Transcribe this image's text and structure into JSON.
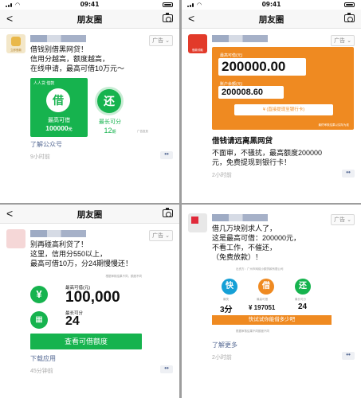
{
  "status": {
    "time": "09:41"
  },
  "nav": {
    "title": "朋友圈",
    "back_glyph": "<"
  },
  "ad_badge": "广告",
  "posts": [
    {
      "avatar_label": "立即借款",
      "text_lines": [
        "借钱别借黑网贷！",
        "信用分越高，额度越高，",
        "在线申请，最高可借10万元～"
      ],
      "image": {
        "brand": "人人贷 借款",
        "card_a": {
          "glyph": "借",
          "label": "最高可借",
          "value": "100000",
          "unit": "元"
        },
        "card_b": {
          "glyph": "还",
          "label": "最长可分",
          "value": "12",
          "unit": "期"
        },
        "note": "广告投放"
      },
      "link": "了解公众号",
      "time": "9小时前"
    },
    {
      "avatar_label": "借款领取",
      "image": {
        "label_max": "最高可借(元)",
        "max_value": "200000.00",
        "label_balance": "账户余额(元)",
        "balance_value": "200008.60",
        "cta": "(直接提现至银行卡)",
        "footer": "最终审核结果以实际为准"
      },
      "headline": "借钱请远离黑网贷",
      "text_lines": [
        "不面审，不骚扰，最高额度200000",
        "元，免费提现到银行卡！"
      ],
      "time": "2小时前"
    },
    {
      "text_lines": [
        "别再碰高利贷了！",
        "这里，信用分550以上，",
        "最高可借10万，分24期慢慢还！"
      ],
      "image": {
        "topnote": "根据审核结果不同，额度不同",
        "icon1": "¥",
        "label_max": "最高可借(元)",
        "max_value": "100,000",
        "label_term": "最长可分",
        "term_value": "24",
        "button": "查看可借额度"
      },
      "link": "下载应用",
      "time": "45分钟前"
    },
    {
      "text_lines": [
        "借几万块别求人了，",
        "这是最高可借：200000元，",
        "不看工作，不催还，",
        "（免费放款）！"
      ],
      "image": {
        "topnote": "出资方：广州市网络小额贷款有限公司",
        "steps": [
          {
            "glyph": "快",
            "sub": "最快",
            "value": "3分"
          },
          {
            "glyph": "借",
            "sub": "最高可借",
            "value": "¥ 197051"
          },
          {
            "glyph": "还",
            "sub": "最长可分",
            "value": "24"
          }
        ],
        "bar": "快试试你能借多少吧",
        "footer": "根据审核结果不同额度不同"
      },
      "link": "了解更多",
      "time": "2小时前"
    }
  ]
}
